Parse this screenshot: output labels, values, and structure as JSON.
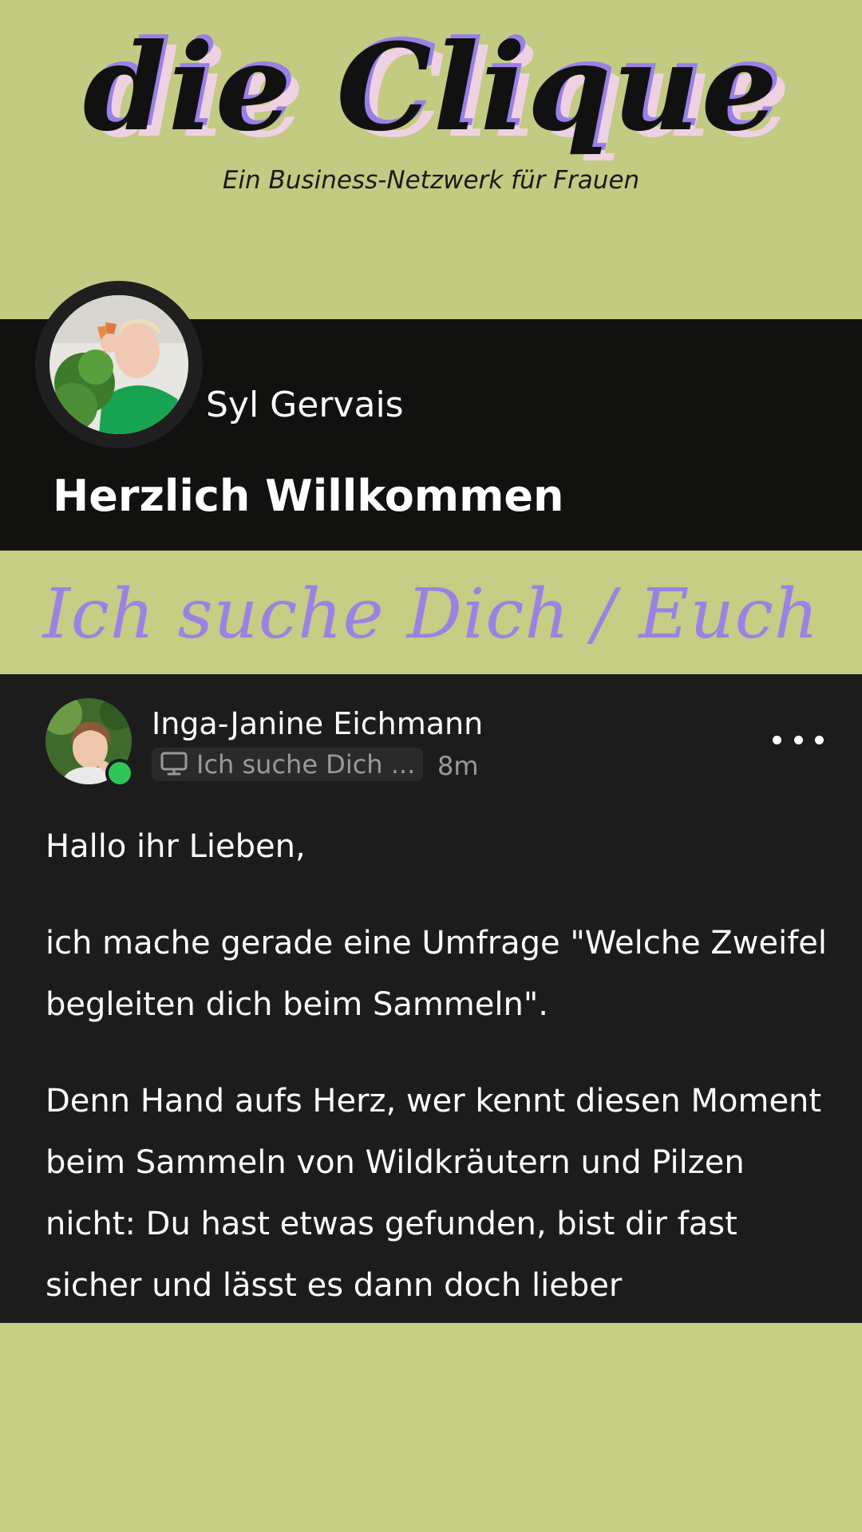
{
  "logo": {
    "title": "die Clique",
    "subtitle": "Ein Business-Netzwerk für Frauen"
  },
  "profile": {
    "name": "Syl Gervais",
    "welcome": "Herzlich Willkommen"
  },
  "section": {
    "title": "Ich suche Dich / Euch"
  },
  "post": {
    "author": "Inga-Janine Eichmann",
    "space": "Ich suche Dich ...",
    "time": "8m",
    "paragraphs": [
      "Hallo ihr Lieben,",
      "ich mache gerade eine Umfrage \"Welche Zweifel begleiten dich beim Sammeln\".",
      "Denn Hand aufs Herz, wer kennt diesen Moment beim Sammeln von Wildkräutern und Pilzen nicht: Du hast etwas gefunden, bist dir fast sicher und lässt es dann doch lieber"
    ]
  },
  "colors": {
    "background": "#c6cd85",
    "dark_band": "#111110",
    "card": "#1c1c1c",
    "accent_purple": "#9b82e4",
    "online": "#2fc45a"
  }
}
